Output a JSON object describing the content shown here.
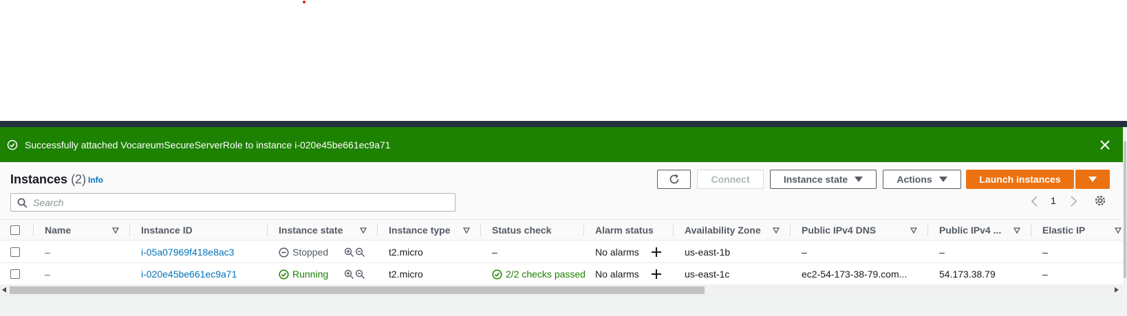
{
  "banner": {
    "message": "Successfully attached VocareumSecureServerRole to instance i-020e45be661ec9a71",
    "bg_color": "#1d8102"
  },
  "header": {
    "title": "Instances",
    "count": "(2)",
    "info": "Info"
  },
  "toolbar": {
    "connect": "Connect",
    "instance_state": "Instance state",
    "actions": "Actions",
    "launch": "Launch instances",
    "accent_color": "#ec7211"
  },
  "search": {
    "placeholder": "Search"
  },
  "pagination": {
    "page": "1"
  },
  "table": {
    "columns": [
      "Name",
      "Instance ID",
      "Instance state",
      "Instance type",
      "Status check",
      "Alarm status",
      "Availability Zone",
      "Public IPv4 DNS",
      "Public IPv4 ...",
      "Elastic IP"
    ],
    "rows": [
      {
        "name": "–",
        "instance_id": "i-05a07969f418e8ac3",
        "state": "Stopped",
        "state_icon": "stopped-icon",
        "type": "t2.micro",
        "status_check": "–",
        "alarm_status": "No alarms",
        "zone": "us-east-1b",
        "dns": "–",
        "ipv4": "–",
        "elastic_ip": "–"
      },
      {
        "name": "–",
        "instance_id": "i-020e45be661ec9a71",
        "state": "Running",
        "state_icon": "running-icon",
        "type": "t2.micro",
        "status_check": "2/2 checks passed",
        "alarm_status": "No alarms",
        "zone": "us-east-1c",
        "dns": "ec2-54-173-38-79.com...",
        "ipv4": "54.173.38.79",
        "elastic_ip": "–"
      }
    ]
  }
}
